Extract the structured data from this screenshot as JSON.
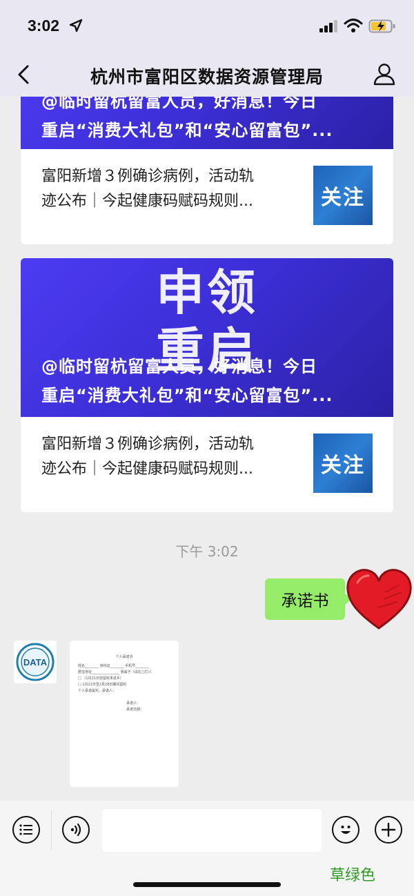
{
  "status_bar": {
    "time": "3:02"
  },
  "nav": {
    "title": "杭州市富阳区数据资源管理局"
  },
  "articles": [
    {
      "banner_title_line1": "@临时留杭留富人员，好消息！今日",
      "banner_title_line2": "重启“消费大礼包”和“安心留富包”...",
      "item_text_line1": "富阳新增３例确诊病例，活动轨",
      "item_text_line2": "迹公布｜今起健康码赋码规则...",
      "thumb_label": "关注"
    },
    {
      "banner_big_line1": "申领",
      "banner_big_line2": "重启",
      "banner_title_line1": "@临时留杭留富人员，好消息！今日",
      "banner_title_line2": "重启“消费大礼包”和“安心留富包”...",
      "item_text_line1": "富阳新增３例确诊病例，活动轨",
      "item_text_line2": "迹公布｜今起健康码赋码规则...",
      "thumb_label": "关注"
    }
  ],
  "chat": {
    "timestamp": "下午 3:02",
    "sent_message": "承诺书",
    "bot_avatar_label": "DATA",
    "document": {
      "title": "个人承诺书",
      "line1": "姓名________ 身份证________ 手机号________",
      "line2": "居住地址________________ 我属于（请在□打√）",
      "line3": "□ （1月21日前留杭未返乡）",
      "line4": "□ 1月21日至2月28日期间留杭",
      "line5": "个人承诺属实，承诺人：",
      "signer": "承诺人：",
      "date": "承诺日期："
    }
  },
  "watermark": "草绿色",
  "colors": {
    "banner": "#3d2fd8",
    "thumb": "#1f63b8",
    "sent_bubble": "#95ec69",
    "background": "#ededed"
  }
}
